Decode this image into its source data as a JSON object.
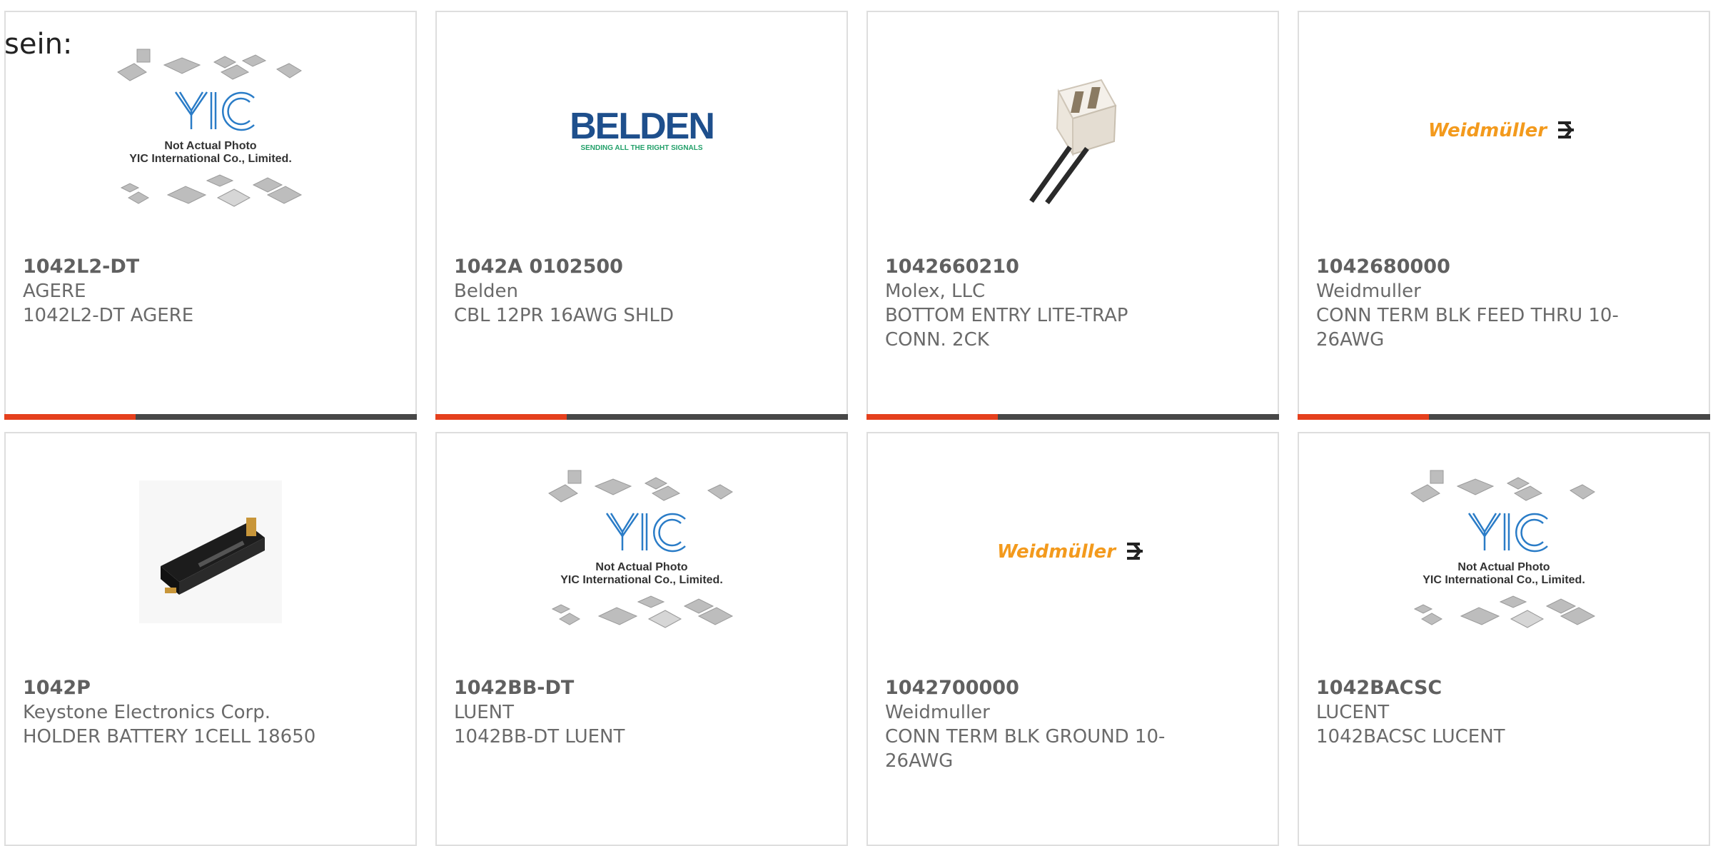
{
  "heading": "sein:",
  "placeholder": {
    "line1": "Not Actual Photo",
    "line2": "YIC International Co., Limited."
  },
  "logos": {
    "belden": "BELDEN",
    "belden_tagline": "SENDING ALL THE RIGHT SIGNALS",
    "weidmuller": "Weidmüller"
  },
  "colors": {
    "accent": "#e5401d",
    "bar": "#474747",
    "weidmuller_orange": "#f39a1d",
    "belden_blue": "#1e4f8c",
    "yic_blue": "#2a7cc7"
  },
  "products": [
    {
      "part": "1042L2-DT",
      "maker": "AGERE",
      "desc": "1042L2-DT AGERE",
      "image": "yic-placeholder"
    },
    {
      "part": "1042A 0102500",
      "maker": "Belden",
      "desc": "CBL 12PR 16AWG SHLD",
      "image": "belden-logo"
    },
    {
      "part": "1042660210",
      "maker": "Molex, LLC",
      "desc": "BOTTOM ENTRY LITE-TRAP CONN. 2CK",
      "image": "connector-photo"
    },
    {
      "part": "1042680000",
      "maker": "Weidmuller",
      "desc": "CONN TERM BLK FEED THRU 10-26AWG",
      "image": "weidmuller-logo"
    },
    {
      "part": "1042P",
      "maker": "Keystone Electronics Corp.",
      "desc": "HOLDER BATTERY 1CELL 18650",
      "image": "battery-holder-photo"
    },
    {
      "part": "1042BB-DT",
      "maker": "LUENT",
      "desc": "1042BB-DT LUENT",
      "image": "yic-placeholder"
    },
    {
      "part": "1042700000",
      "maker": "Weidmuller",
      "desc": "CONN TERM BLK GROUND 10-26AWG",
      "image": "weidmuller-logo"
    },
    {
      "part": "1042BACSC",
      "maker": "LUCENT",
      "desc": "1042BACSC LUCENT",
      "image": "yic-placeholder"
    }
  ]
}
